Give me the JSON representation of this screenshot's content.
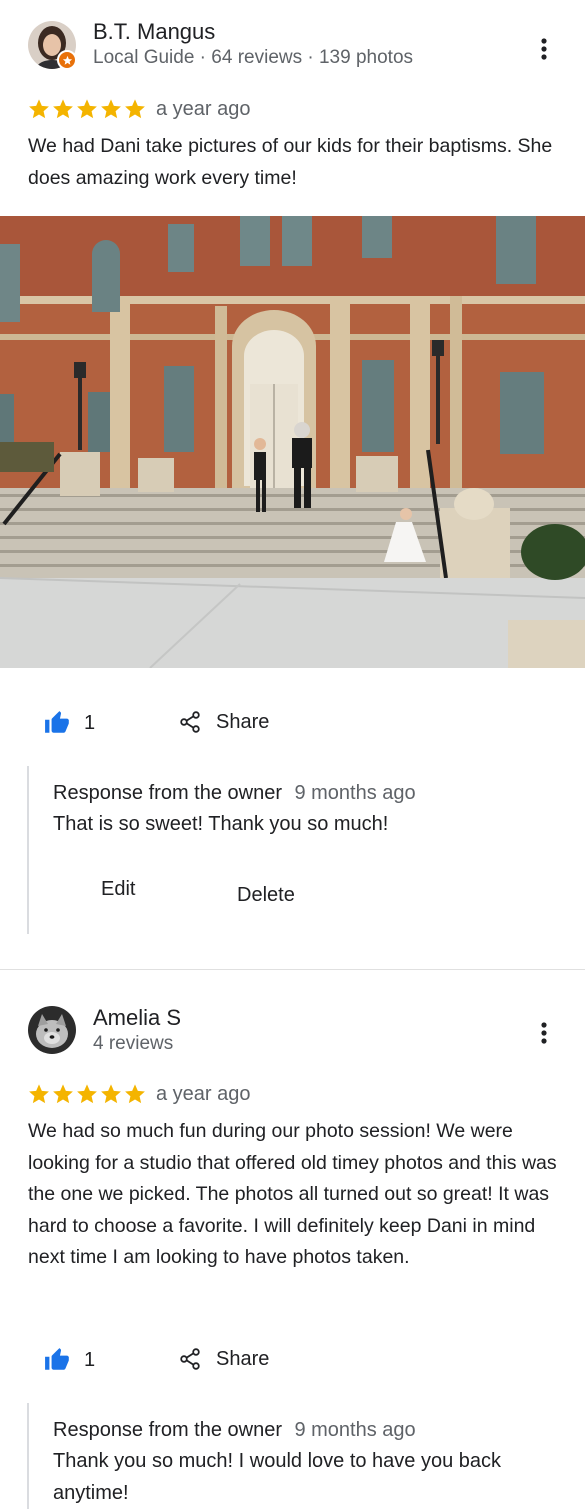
{
  "reviews": [
    {
      "author": "B.T. Mangus",
      "meta": "Local Guide · 64 reviews · 139 photos",
      "avatar_icon": "user-avatar-photo",
      "badge_icon": "local-guide-star-badge",
      "rating": 5,
      "time": "a year ago",
      "text": "We had Dani take pictures of our kids for their baptisms. She does amazing work every time!",
      "photo_icon": "church-building-photo",
      "likes": "1",
      "share_label": "Share",
      "owner_response": {
        "title": "Response from the owner",
        "time": "9 months ago",
        "text": "That is so sweet! Thank you so much!",
        "edit_label": "Edit",
        "delete_label": "Delete"
      }
    },
    {
      "author": "Amelia S",
      "meta": "4 reviews",
      "avatar_icon": "dog-avatar-photo",
      "rating": 5,
      "time": "a year ago",
      "text": "We had so much fun during our photo session! We were looking for a studio that offered old timey photos and this was the one we picked. The photos all turned out so great! It was hard to choose a favorite. I will definitely keep Dani in mind next time I am looking to have photos taken.",
      "likes": "1",
      "share_label": "Share",
      "owner_response": {
        "title": "Response from the owner",
        "time": "9 months ago",
        "text": "Thank you so much! I would love to have you back anytime!"
      }
    }
  ],
  "colors": {
    "star": "#f4b400",
    "like": "#1a73e8",
    "guide_badge": "#e8710a",
    "secondary_text": "#5f6368"
  }
}
